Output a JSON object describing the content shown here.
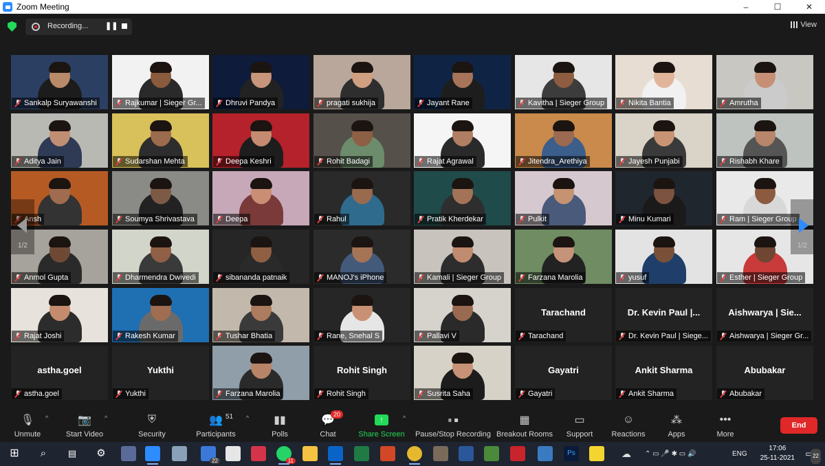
{
  "window": {
    "title": "Zoom Meeting",
    "buttons": [
      "–",
      "☐",
      "✕"
    ]
  },
  "topbar": {
    "recording_label": "Recording...",
    "view_label": "View"
  },
  "pager": {
    "left_page": "1/2",
    "right_page": "1/2"
  },
  "tiles": [
    {
      "name": "Sankalp Suryawanshi",
      "type": "video",
      "bg": "#2b3f63",
      "skin": "#b98a6a",
      "shirt": "#1c1c1c"
    },
    {
      "name": "Rajkumar | Sieger Gr...",
      "type": "video",
      "bg": "#f2f2f2",
      "skin": "#8a5a3c",
      "shirt": "#2a2a2a"
    },
    {
      "name": "Dhruvi Pandya",
      "type": "video",
      "bg": "#0e1b3b",
      "skin": "#c7957a",
      "shirt": "#222"
    },
    {
      "name": "pragati sukhija",
      "type": "video",
      "bg": "#b8a79a",
      "skin": "#cf9f82",
      "shirt": "#2e2e2e"
    },
    {
      "name": "Jayant Rane",
      "type": "video",
      "bg": "#0f2445",
      "skin": "#a7745a",
      "shirt": "#1d1d1d"
    },
    {
      "name": "Kavitha | Sieger Group",
      "type": "video",
      "bg": "#e6e6e6",
      "skin": "#8e5c40",
      "shirt": "#3c3c3c"
    },
    {
      "name": "Nikita Bantia",
      "type": "video",
      "bg": "#e7ddd2",
      "skin": "#e0b59a",
      "shirt": "#f1f1f1"
    },
    {
      "name": "Amrutha",
      "type": "video",
      "bg": "#c9c7c1",
      "skin": "#c69076",
      "shirt": "#cbcbcb"
    },
    {
      "name": "Aditya Jain",
      "type": "video",
      "bg": "#b9b9b4",
      "skin": "#c08f73",
      "shirt": "#2f3a55"
    },
    {
      "name": "Sudarshan Mehta",
      "type": "video",
      "bg": "#d8c15a",
      "skin": "#9c6a4c",
      "shirt": "#2d2d2d"
    },
    {
      "name": "Deepa Keshri",
      "type": "video",
      "bg": "#b5222b",
      "skin": "#c48b70",
      "shirt": "#1d1d1d"
    },
    {
      "name": "Rohit Badagi",
      "type": "video",
      "bg": "#55504a",
      "skin": "#8d5f45",
      "shirt": "#6c8c6c"
    },
    {
      "name": "Rajat Agrawal",
      "type": "video",
      "bg": "#f5f5f5",
      "skin": "#b07e62",
      "shirt": "#2a2a2a"
    },
    {
      "name": "Jitendra_Arethiya",
      "type": "video",
      "bg": "#c98a4b",
      "skin": "#9b6a50",
      "shirt": "#3c5e8a"
    },
    {
      "name": "Jayesh Punjabi",
      "type": "video",
      "bg": "#d9d3c8",
      "skin": "#c99473",
      "shirt": "#3a3a3a"
    },
    {
      "name": "Rishabh Khare",
      "type": "video",
      "bg": "#bfc3c0",
      "skin": "#b8866a",
      "shirt": "#555"
    },
    {
      "name": "Ansh",
      "type": "video",
      "bg": "#b65a24",
      "skin": "#a06c50",
      "shirt": "#333"
    },
    {
      "name": "Soumya Shrivastava",
      "type": "video",
      "bg": "#8a8a86",
      "skin": "#7c5a45",
      "shirt": "#222"
    },
    {
      "name": "Deepa",
      "type": "video",
      "bg": "#c7a8b8",
      "skin": "#c98e74",
      "shirt": "#7a3a3a"
    },
    {
      "name": "Rahul",
      "type": "video",
      "bg": "#2a2a2a",
      "skin": "#9a6a4e",
      "shirt": "#2f6b8c"
    },
    {
      "name": "Pratik Kherdekar",
      "type": "video",
      "bg": "#1f4b4a",
      "skin": "#a47357",
      "shirt": "#2e2e2e"
    },
    {
      "name": "Pulkit",
      "type": "video",
      "bg": "#d6c8cf",
      "skin": "#c69372",
      "shirt": "#4a5a7a"
    },
    {
      "name": "Minu Kumari",
      "type": "video",
      "bg": "#20262e",
      "skin": "#7b5340",
      "shirt": "#1a1a1a"
    },
    {
      "name": "Ram | Sieger Group",
      "type": "video",
      "bg": "#e9e9e9",
      "skin": "#8c5a3e",
      "shirt": "#d8d8d8"
    },
    {
      "name": "Anmol Gupta",
      "type": "video",
      "bg": "#a6a29c",
      "skin": "#6e4a36",
      "shirt": "#2a2a2a"
    },
    {
      "name": "Dharmendra Dwivedi",
      "type": "video",
      "bg": "#d2d5c9",
      "skin": "#8f6046",
      "shirt": "#3a3a3a"
    },
    {
      "name": "sibananda patnaik",
      "type": "video",
      "bg": "#262626",
      "skin": "#8f5f44",
      "shirt": "#2a2a2a"
    },
    {
      "name": "MANOJ's iPhone",
      "type": "video",
      "bg": "#2b2b2b",
      "skin": "#a57456",
      "shirt": "#445a7a"
    },
    {
      "name": "Kamali | Sieger Group",
      "type": "video",
      "bg": "#c8c3bd",
      "skin": "#c08b6e",
      "shirt": "#2d2d2d",
      "active": true
    },
    {
      "name": "Farzana Marolia",
      "type": "video",
      "bg": "#6f8c62",
      "skin": "#c4937a",
      "shirt": "#222"
    },
    {
      "name": "yusuf",
      "type": "video",
      "bg": "#e3e3e3",
      "skin": "#7a5038",
      "shirt": "#1f3f6a"
    },
    {
      "name": "Esther | Sieger Group",
      "type": "video",
      "bg": "#e6e6e6",
      "skin": "#6e4632",
      "shirt": "#c93a3a"
    },
    {
      "name": "Rajat Joshi",
      "type": "video",
      "bg": "#e7e3dc",
      "skin": "#c48c6c",
      "shirt": "#2c2c2c"
    },
    {
      "name": "Rakesh Kumar",
      "type": "video",
      "bg": "#1f6fb3",
      "skin": "#a06d50",
      "shirt": "#6a6a6a"
    },
    {
      "name": "Tushar Bhatia",
      "type": "video",
      "bg": "#c2b9ac",
      "skin": "#ad7b5e",
      "shirt": "#3a3a3a"
    },
    {
      "name": "Rane, Snehal S",
      "type": "video",
      "bg": "#262626",
      "skin": "#c99174",
      "shirt": "#e6e6e6"
    },
    {
      "name": "Pallavi V",
      "type": "video",
      "bg": "#d6d3cd",
      "skin": "#9a6a50",
      "shirt": "#2a2a2a"
    },
    {
      "name": "Tarachand",
      "type": "name",
      "big": "Tarachand"
    },
    {
      "name": "Dr. Kevin Paul | Siege...",
      "type": "name",
      "big": "Dr. Kevin Paul |..."
    },
    {
      "name": "Aishwarya | Sieger Gr...",
      "type": "name",
      "big": "Aishwarya | Sie..."
    },
    {
      "name": "astha.goel",
      "type": "name",
      "big": "astha.goel"
    },
    {
      "name": "Yukthi",
      "type": "name",
      "big": "Yukthi"
    },
    {
      "name": "Farzana Marolia",
      "type": "video",
      "bg": "#8f9ea8",
      "skin": "#b78468",
      "shirt": "#2a2a2a"
    },
    {
      "name": "Rohit Singh",
      "type": "name",
      "big": "Rohit Singh"
    },
    {
      "name": "Susrita Saha",
      "type": "video",
      "bg": "#d7d2c7",
      "skin": "#c79275",
      "shirt": "#1c1c1c"
    },
    {
      "name": "Gayatri",
      "type": "name",
      "big": "Gayatri"
    },
    {
      "name": "Ankit Sharma",
      "type": "name",
      "big": "Ankit Sharma"
    },
    {
      "name": "Abubakar",
      "type": "name",
      "big": "Abubakar"
    }
  ],
  "toolbar": {
    "unmute": "Unmute",
    "start_video": "Start Video",
    "security": "Security",
    "participants": "Participants",
    "participants_count": "51",
    "polls": "Polls",
    "chat": "Chat",
    "chat_badge": "20",
    "share_screen": "Share Screen",
    "pause_recording": "Pause/Stop Recording",
    "breakout_rooms": "Breakout Rooms",
    "support": "Support",
    "reactions": "Reactions",
    "apps": "Apps",
    "more": "More",
    "end": "End"
  },
  "taskbar": {
    "language": "ENG",
    "time": "17:06",
    "date": "25-11-2021",
    "notifications": "22",
    "app_badges": {
      "files": "22",
      "whatsapp": "11"
    }
  },
  "colors": {
    "accent": "#2d8cff",
    "end": "#e02828",
    "share": "#23d959"
  }
}
